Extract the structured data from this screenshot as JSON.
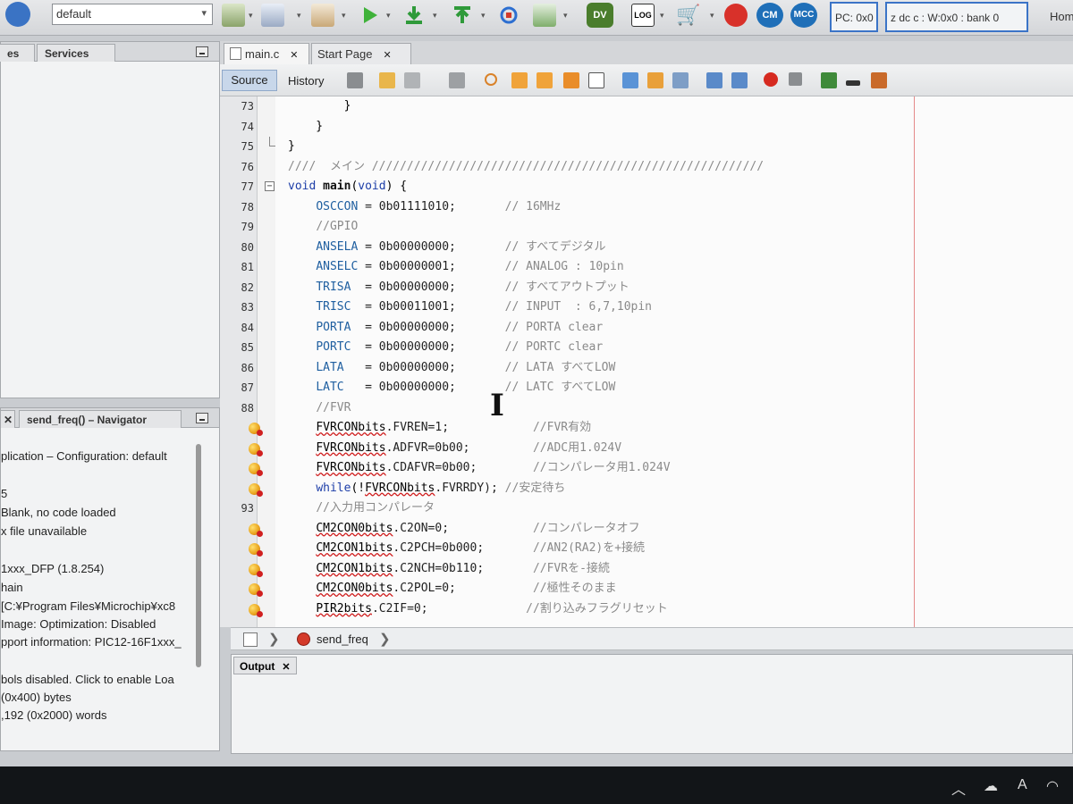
{
  "toolbar": {
    "config_value": "default",
    "status_pc": "PC: 0x0",
    "status_regs": "z dc c  : W:0x0 : bank 0",
    "home_label": "Hom",
    "badges": [
      "DV",
      "CM",
      "MCC"
    ],
    "log_label": "LOG",
    "accent": "#3b74c7"
  },
  "left_panel": {
    "tabs": [
      "es",
      "Services"
    ]
  },
  "navigator": {
    "tabs": [
      "send_freq() – Navigator"
    ],
    "lines": [
      "plication – Configuration: default",
      "5",
      " Blank, no code loaded",
      "x file unavailable",
      "1xxx_DFP (1.8.254)",
      "hain",
      "  [C:¥Program Files¥Microchip¥xc8",
      " Image: Optimization: Disabled",
      "pport information: PIC12-16F1xxx_",
      "bols disabled. Click to enable Loa",
      "(0x400) bytes",
      ",192 (0x2000) words"
    ]
  },
  "editor": {
    "tabs": [
      "main.c",
      "Start Page"
    ],
    "source_label": "Source",
    "history_label": "History",
    "lines": [
      {
        "n": "73",
        "mark": false,
        "fold": "",
        "parts": [
          [
            "        }",
            "plain"
          ]
        ]
      },
      {
        "n": "74",
        "mark": false,
        "fold": "",
        "parts": [
          [
            "    }",
            "plain"
          ]
        ]
      },
      {
        "n": "75",
        "mark": false,
        "fold": "end",
        "parts": [
          [
            "}",
            "plain"
          ]
        ]
      },
      {
        "n": "76",
        "mark": false,
        "fold": "",
        "parts": [
          [
            "////  メイン ////////////////////////////////////////////////////////",
            "cmt"
          ]
        ]
      },
      {
        "n": "77",
        "mark": false,
        "fold": "open",
        "parts": [
          [
            "void",
            "kw"
          ],
          [
            " main",
            "fn"
          ],
          [
            "(",
            "plain"
          ],
          [
            "void",
            "kw"
          ],
          [
            ") {",
            "plain"
          ]
        ]
      },
      {
        "n": "78",
        "mark": false,
        "fold": "",
        "parts": [
          [
            "    ",
            "plain"
          ],
          [
            "OSCCON",
            "reg"
          ],
          [
            " = 0b01111010;       ",
            "num"
          ],
          [
            "// 16MHz",
            "cmt"
          ]
        ]
      },
      {
        "n": "79",
        "mark": false,
        "fold": "",
        "parts": [
          [
            "    ",
            "plain"
          ],
          [
            "//GPIO",
            "cmt"
          ]
        ]
      },
      {
        "n": "80",
        "mark": false,
        "fold": "",
        "parts": [
          [
            "    ",
            "plain"
          ],
          [
            "ANSELA",
            "reg"
          ],
          [
            " = 0b00000000;       ",
            "num"
          ],
          [
            "// すべてデジタル",
            "cmt"
          ]
        ]
      },
      {
        "n": "81",
        "mark": false,
        "fold": "",
        "parts": [
          [
            "    ",
            "plain"
          ],
          [
            "ANSELC",
            "reg"
          ],
          [
            " = 0b00000001;       ",
            "num"
          ],
          [
            "// ANALOG : 10pin",
            "cmt"
          ]
        ]
      },
      {
        "n": "82",
        "mark": false,
        "fold": "",
        "parts": [
          [
            "    ",
            "plain"
          ],
          [
            "TRISA",
            "reg"
          ],
          [
            "  = 0b00000000;       ",
            "num"
          ],
          [
            "// すべてアウトプット",
            "cmt"
          ]
        ]
      },
      {
        "n": "83",
        "mark": false,
        "fold": "",
        "parts": [
          [
            "    ",
            "plain"
          ],
          [
            "TRISC",
            "reg"
          ],
          [
            "  = 0b00011001;       ",
            "num"
          ],
          [
            "// INPUT  : 6,7,10pin",
            "cmt"
          ]
        ]
      },
      {
        "n": "84",
        "mark": false,
        "fold": "",
        "parts": [
          [
            "    ",
            "plain"
          ],
          [
            "PORTA",
            "reg"
          ],
          [
            "  = 0b00000000;       ",
            "num"
          ],
          [
            "// PORTA clear",
            "cmt"
          ]
        ]
      },
      {
        "n": "85",
        "mark": false,
        "fold": "",
        "parts": [
          [
            "    ",
            "plain"
          ],
          [
            "PORTC",
            "reg"
          ],
          [
            "  = 0b00000000;       ",
            "num"
          ],
          [
            "// PORTC clear",
            "cmt"
          ]
        ]
      },
      {
        "n": "86",
        "mark": false,
        "fold": "",
        "parts": [
          [
            "    ",
            "plain"
          ],
          [
            "LATA",
            "reg"
          ],
          [
            "   = 0b00000000;       ",
            "num"
          ],
          [
            "// LATA すべてLOW",
            "cmt"
          ]
        ]
      },
      {
        "n": "87",
        "mark": false,
        "fold": "",
        "parts": [
          [
            "    ",
            "plain"
          ],
          [
            "LATC",
            "reg"
          ],
          [
            "   = 0b00000000;       ",
            "num"
          ],
          [
            "// LATC すべてLOW",
            "cmt"
          ]
        ]
      },
      {
        "n": "88",
        "mark": false,
        "fold": "",
        "parts": [
          [
            "    ",
            "plain"
          ],
          [
            "//FVR",
            "cmt"
          ]
        ]
      },
      {
        "n": "",
        "mark": true,
        "fold": "",
        "parts": [
          [
            "    ",
            "plain"
          ],
          [
            "FVRCONbits",
            "sq"
          ],
          [
            ".FVREN=1;            ",
            "num"
          ],
          [
            "//FVR有効",
            "cmt"
          ]
        ]
      },
      {
        "n": "",
        "mark": true,
        "fold": "",
        "parts": [
          [
            "    ",
            "plain"
          ],
          [
            "FVRCONbits",
            "sq"
          ],
          [
            ".ADFVR=0b00;         ",
            "num"
          ],
          [
            "//ADC用1.024V",
            "cmt"
          ]
        ]
      },
      {
        "n": "",
        "mark": true,
        "fold": "",
        "parts": [
          [
            "    ",
            "plain"
          ],
          [
            "FVRCONbits",
            "sq"
          ],
          [
            ".CDAFVR=0b00;        ",
            "num"
          ],
          [
            "//コンパレータ用1.024V",
            "cmt"
          ]
        ]
      },
      {
        "n": "",
        "mark": true,
        "fold": "",
        "parts": [
          [
            "    ",
            "plain"
          ],
          [
            "while",
            "kw"
          ],
          [
            "(!",
            "plain"
          ],
          [
            "FVRCONbits",
            "sq"
          ],
          [
            ".FVRRDY); ",
            "num"
          ],
          [
            "//安定待ち",
            "cmt"
          ]
        ]
      },
      {
        "n": "93",
        "mark": false,
        "fold": "",
        "parts": [
          [
            "    ",
            "plain"
          ],
          [
            "//入力用コンパレータ",
            "cmt"
          ]
        ]
      },
      {
        "n": "",
        "mark": true,
        "fold": "",
        "parts": [
          [
            "    ",
            "plain"
          ],
          [
            "CM2CON0bits",
            "sq"
          ],
          [
            ".C2ON=0;            ",
            "num"
          ],
          [
            "//コンパレータオフ",
            "cmt"
          ]
        ]
      },
      {
        "n": "",
        "mark": true,
        "fold": "",
        "parts": [
          [
            "    ",
            "plain"
          ],
          [
            "CM2CON1bits",
            "sq"
          ],
          [
            ".C2PCH=0b000;       ",
            "num"
          ],
          [
            "//AN2(RA2)を+接続",
            "cmt"
          ]
        ]
      },
      {
        "n": "",
        "mark": true,
        "fold": "",
        "parts": [
          [
            "    ",
            "plain"
          ],
          [
            "CM2CON1bits",
            "sq"
          ],
          [
            ".C2NCH=0b110;       ",
            "num"
          ],
          [
            "//FVRを-接続",
            "cmt"
          ]
        ]
      },
      {
        "n": "",
        "mark": true,
        "fold": "",
        "parts": [
          [
            "    ",
            "plain"
          ],
          [
            "CM2CON0bits",
            "sq"
          ],
          [
            ".C2POL=0;           ",
            "num"
          ],
          [
            "//極性そのまま",
            "cmt"
          ]
        ]
      },
      {
        "n": "",
        "mark": true,
        "fold": "",
        "parts": [
          [
            "    ",
            "plain"
          ],
          [
            "PIR2bits",
            "sq"
          ],
          [
            ".C2IF=0;              ",
            "num"
          ],
          [
            "//割り込みフラグリセット",
            "cmt"
          ]
        ]
      }
    ]
  },
  "breadcrumb": {
    "function": "send_freq"
  },
  "output": {
    "tab_label": "Output"
  },
  "taskbar": {
    "ime": "A"
  }
}
